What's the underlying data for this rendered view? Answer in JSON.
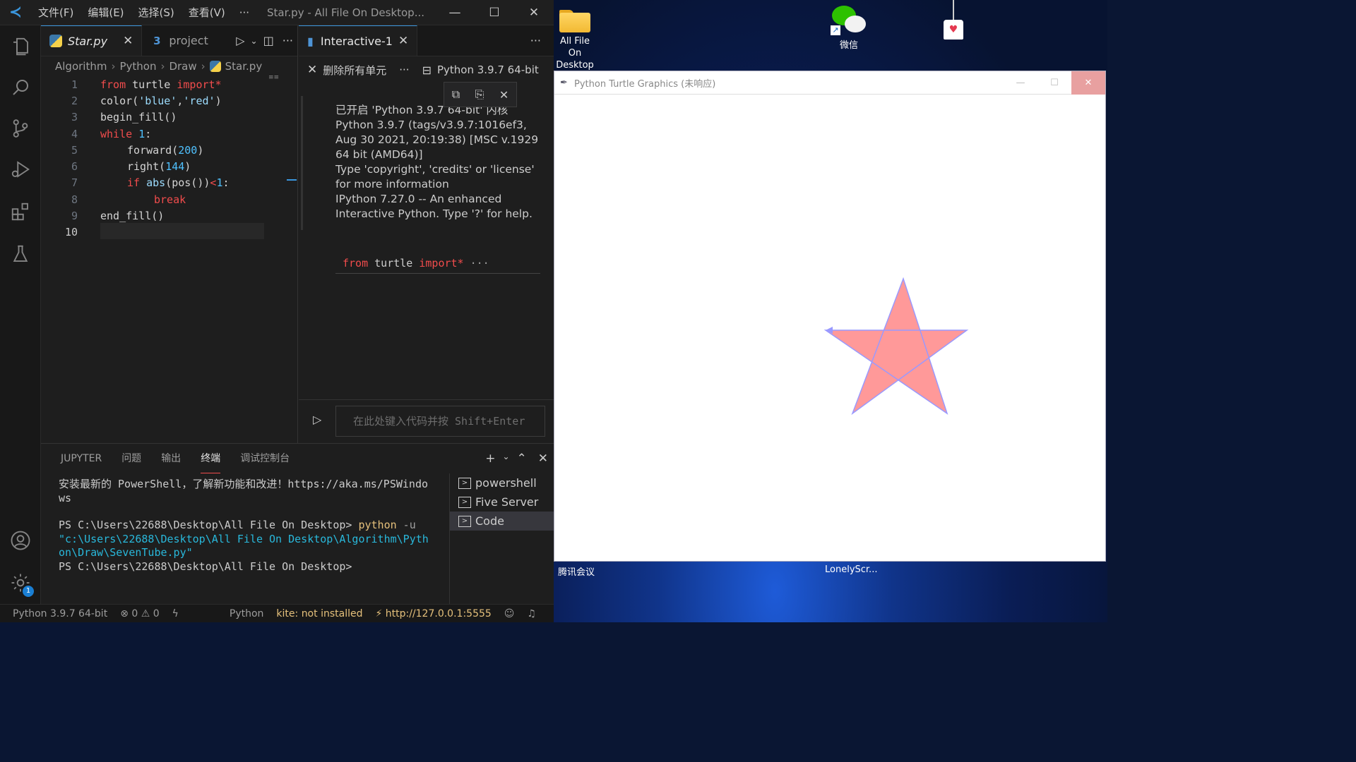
{
  "vscode": {
    "menu": [
      "文件(F)",
      "编辑(E)",
      "选择(S)",
      "查看(V)",
      "···"
    ],
    "window_title": "Star.py - All File On Desktop...",
    "window_controls": [
      "—",
      "☐",
      "✕"
    ]
  },
  "editor": {
    "tabs": [
      {
        "label": "Star.py",
        "close": "✕"
      },
      {
        "label": "project"
      }
    ],
    "breadcrumb": [
      "Algorithm",
      "Python",
      "Draw",
      "Star.py"
    ],
    "lines": [
      "1",
      "2",
      "3",
      "4",
      "5",
      "6",
      "7",
      "8",
      "9",
      "10"
    ],
    "code": {
      "l1_kw": "from",
      "l1_mod": " turtle ",
      "l1_imp": "import*",
      "l2_fn": "color(",
      "l2_s1": "'blue'",
      "l2_c": ",",
      "l2_s2": "'red'",
      "l2_e": ")",
      "l3": "begin_fill()",
      "l4_kw": "while",
      "l4_sp": " ",
      "l4_num": "1",
      "l4_e": ":",
      "l5_fn": "forward(",
      "l5_num": "200",
      "l5_e": ")",
      "l6_fn": "right(",
      "l6_num": "144",
      "l6_e": ")",
      "l7_kw": "if",
      "l7_sp": " ",
      "l7_abs": "abs",
      "l7_mid": "(pos())",
      "l7_lt": "<",
      "l7_num": "1",
      "l7_e": ":",
      "l8_kw": "break",
      "l9": "end_fill()"
    }
  },
  "interactive": {
    "tab_label": "Interactive-1",
    "clear_all": "删除所有单元",
    "more": "···",
    "kernel": "Python 3.9.7 64-bit",
    "output": [
      "已开启 'Python 3.9.7 64-bit' 内核",
      "Python 3.9.7 (tags/v3.9.7:1016ef3, Aug 30 2021, 20:19:38) [MSC v.1929 64 bit (AMD64)]",
      "Type 'copyright', 'credits' or 'license' for more information",
      "IPython 7.27.0 -- An enhanced Interactive Python. Type '?' for help."
    ],
    "cell_kw1": "from",
    "cell_mod": " turtle ",
    "cell_kw2": "import*",
    "cell_more": " ···",
    "input_placeholder": "在此处键入代码并按 Shift+Enter"
  },
  "panel": {
    "tabs": [
      "JUPYTER",
      "问题",
      "输出",
      "终端",
      "调试控制台"
    ],
    "active_tab": "终端",
    "terminal": {
      "l1": "安装最新的 PowerShell，了解新功能和改进！https://aka.ms/PSWindows",
      "prompt1": "PS C:\\Users\\22688\\Desktop\\All File On Desktop> ",
      "cmd": "python",
      "flag": " -u ",
      "path": "\"c:\\Users\\22688\\Desktop\\All File On Desktop\\Algorithm\\Python\\Draw\\SevenTube.py\"",
      "prompt2": "PS C:\\Users\\22688\\Desktop\\All File On Desktop>"
    },
    "terminals": [
      "powershell",
      "Five Server",
      "Code"
    ]
  },
  "status": {
    "interpreter": "Python 3.9.7 64-bit",
    "errors": "⊗ 0 ⚠ 0",
    "language": "Python",
    "kite": "kite: not installed",
    "live_server": "⚡ http://127.0.0.1:5555",
    "settings_badge": "1"
  },
  "desktop": {
    "folder_label": "All File On Desktop",
    "wechat_label": "微信",
    "taskbar_labels": [
      "腾讯会议",
      "LonelyScr..."
    ]
  },
  "turtle_window": {
    "title": "Python Turtle Graphics (未响应)",
    "star_fill": "#ff9999",
    "star_stroke": "#9999ff"
  },
  "colors": {
    "accent": "#3a96dd",
    "keyword": "#f14c4c",
    "string": "#9cdcfe"
  }
}
